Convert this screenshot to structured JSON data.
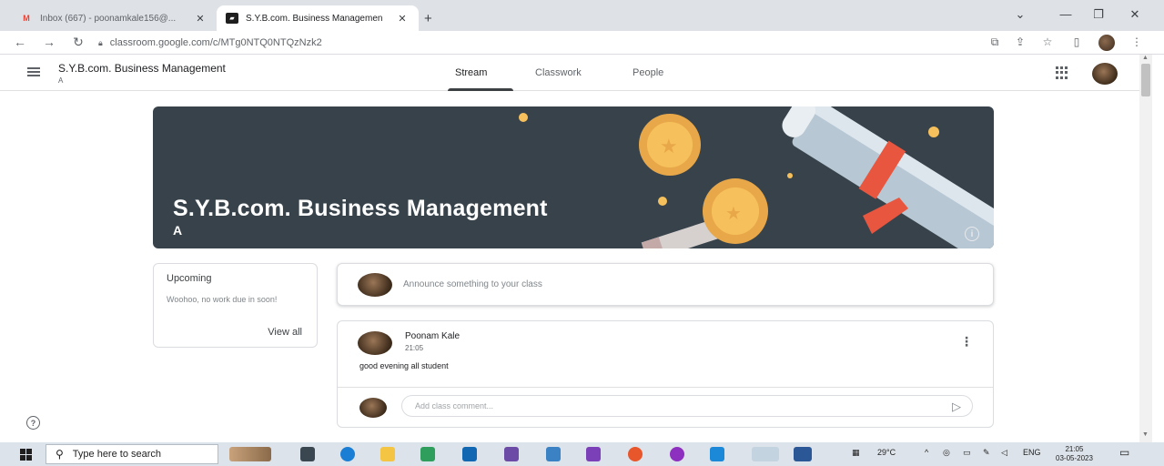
{
  "browser": {
    "tabs": [
      {
        "label": "Inbox (667) - poonamkale156@...",
        "icon": "gmail-icon",
        "active": false
      },
      {
        "label": "S.Y.B.com. Business Managemen",
        "icon": "classroom-icon",
        "active": true
      }
    ],
    "new_tab": "+",
    "url": "classroom.google.com/c/MTg0NTQ0NTQzNzk2"
  },
  "classroom": {
    "class_name": "S.Y.B.com. Business Management",
    "section": "A",
    "tabs": [
      {
        "label": "Stream",
        "active": true
      },
      {
        "label": "Classwork",
        "active": false
      },
      {
        "label": "People",
        "active": false
      }
    ],
    "banner": {
      "title": "S.Y.B.com. Business Management",
      "section": "A",
      "bg_color": "#37424a"
    },
    "upcoming": {
      "title": "Upcoming",
      "text": "Woohoo, no work due in soon!",
      "view_all": "View all"
    },
    "announce_placeholder": "Announce something to your class",
    "post": {
      "author": "Poonam Kale",
      "time": "21:05",
      "body": "good evening all student",
      "comment_placeholder": "Add class comment..."
    }
  },
  "taskbar": {
    "search_placeholder": "Type here to search",
    "weather": "29°C",
    "language": "ENG",
    "time": "21:05",
    "date": "03-05-2023"
  }
}
